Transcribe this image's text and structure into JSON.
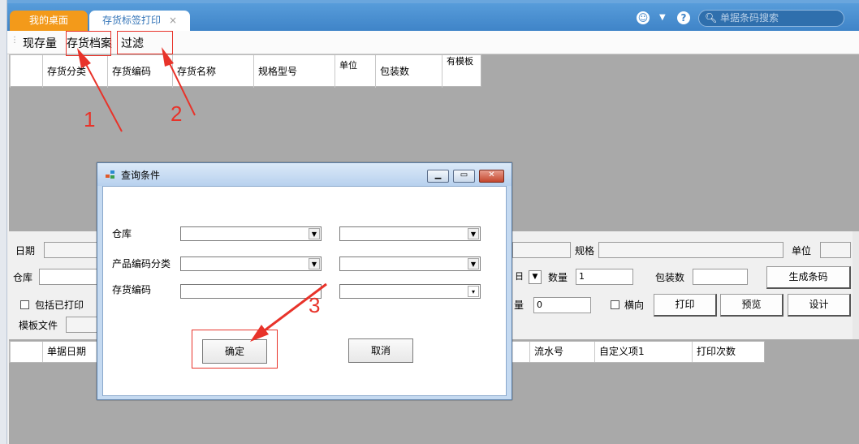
{
  "tabs": {
    "desktop": "我的桌面",
    "active": "存货标签打印",
    "close": "×"
  },
  "header": {
    "search_placeholder": "单据条码搜索"
  },
  "toolbar": {
    "stock": "现存量",
    "archive": "存货档案",
    "filter": "过滤"
  },
  "grid1": {
    "columns": [
      "存货分类",
      "存货编码",
      "存货名称",
      "规格型号",
      "单位",
      "包装数",
      "有模板"
    ]
  },
  "form": {
    "date": "日期",
    "warehouse": "仓库",
    "spec": "规格",
    "unit": "单位",
    "quantity": "数量",
    "quantity_value": "1",
    "pack_count": "包装数",
    "generate_barcode": "生成条码",
    "include_printed": "包括已打印",
    "qty2": "量",
    "qty2_value": "0",
    "landscape": "横向",
    "print": "打印",
    "preview": "预览",
    "design": "设计",
    "template_file": "模板文件",
    "partial_day": "日"
  },
  "grid2": {
    "columns": [
      "单据日期",
      "流水号",
      "自定义项1",
      "打印次数"
    ]
  },
  "dialog": {
    "title": "查询条件",
    "warehouse": "仓库",
    "category": "产品编码分类",
    "code": "存货编码",
    "ok": "确定",
    "cancel": "取消"
  },
  "annotations": {
    "a1": "1",
    "a2": "2",
    "a3": "3"
  },
  "colors": {
    "accent": "#3f84c8",
    "tab_orange": "#f39a1a",
    "annotation": "#e8332a"
  }
}
